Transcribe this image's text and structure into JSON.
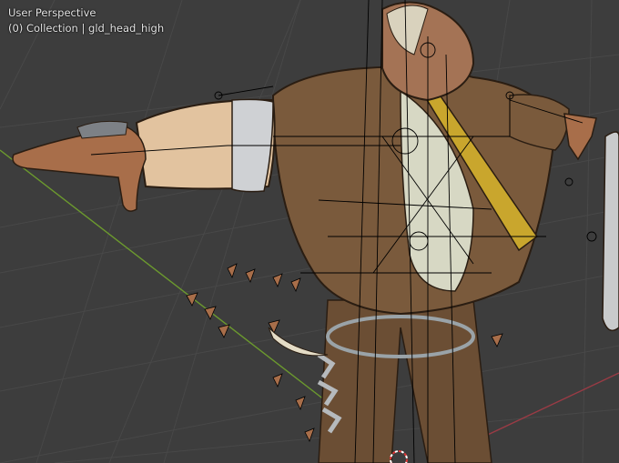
{
  "viewport": {
    "view_name": "User Perspective",
    "collection_frame": "(0)",
    "collection_name": "Collection",
    "active_object": "gld_head_high",
    "separator": " | "
  },
  "colors": {
    "background": "#3d3d3d",
    "grid": "#484848",
    "x_axis": "#9a3b45",
    "y_axis": "#6c9a2e",
    "bone_wire": "#000000",
    "coat": "#7a5a3c",
    "skin": "#e2c39f",
    "sash": "#c9a62d"
  },
  "icons": [
    "armature-bones",
    "3d-cursor-icon"
  ]
}
